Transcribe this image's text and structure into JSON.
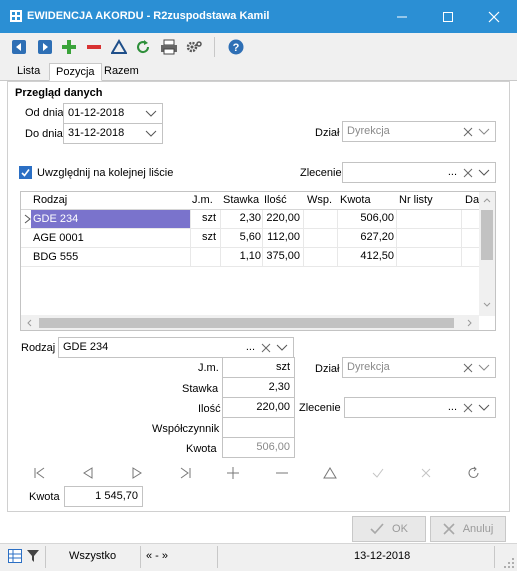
{
  "window": {
    "title": "EWIDENCJA AKORDU - R2zuspodstawa Kamil",
    "accent": "#2b8fd4"
  },
  "toolbar": {
    "icons": [
      "nav-back-icon",
      "nav-forward-icon",
      "add-icon",
      "remove-icon",
      "filter-triangle-icon",
      "refresh-icon",
      "print-icon",
      "settings-icon",
      "help-icon"
    ]
  },
  "tabs": [
    {
      "label": "Lista"
    },
    {
      "label": "Pozycja"
    },
    {
      "label": "Razem"
    }
  ],
  "review": {
    "section_title": "Przegląd danych",
    "from_label": "Od dnia",
    "from_value": "01-12-2018",
    "to_label": "Do dnia",
    "to_value": "31-12-2018",
    "dept_label": "Dział",
    "dept_value": "Dyrekcja",
    "checkbox_label": "Uwzględnij na kolejnej liście",
    "checkbox_checked": true,
    "order_label": "Zlecenie",
    "order_value": "..."
  },
  "grid": {
    "columns": [
      "Rodzaj",
      "J.m.",
      "Stawka",
      "Ilość",
      "Wsp.",
      "Kwota",
      "Nr listy",
      "Da"
    ],
    "rows": [
      {
        "rodzaj": "GDE 234",
        "jm": "szt",
        "stawka": "2,30",
        "ilosc": "220,00",
        "wsp": "",
        "kwota": "506,00",
        "nr": ""
      },
      {
        "rodzaj": "AGE 0001",
        "jm": "szt",
        "stawka": "5,60",
        "ilosc": "112,00",
        "wsp": "",
        "kwota": "627,20",
        "nr": ""
      },
      {
        "rodzaj": "BDG 555",
        "jm": "",
        "stawka": "1,10",
        "ilosc": "375,00",
        "wsp": "",
        "kwota": "412,50",
        "nr": ""
      }
    ],
    "selected_row": 0,
    "selection_color": "#7a73cc"
  },
  "detail": {
    "rodzaj_label": "Rodzaj",
    "rodzaj_value": "GDE 234",
    "rodzaj_dots": "...",
    "jm_label": "J.m.",
    "jm_value": "szt",
    "stawka_label": "Stawka",
    "stawka_value": "2,30",
    "ilosc_label": "Ilość",
    "ilosc_value": "220,00",
    "wsp_label": "Współczynnik",
    "wsp_value": "",
    "kwota_label": "Kwota",
    "kwota_value": "506,00",
    "dzial_label": "Dział",
    "dzial_value": "Dyrekcja",
    "zlecenie_label": "Zlecenie",
    "zlecenie_value": "..."
  },
  "total": {
    "label": "Kwota",
    "value": "1 545,70"
  },
  "buttons": {
    "ok": "OK",
    "cancel": "Anuluj"
  },
  "status": {
    "filter": "Wszystko",
    "range": "« - »",
    "date": "13-12-2018"
  }
}
